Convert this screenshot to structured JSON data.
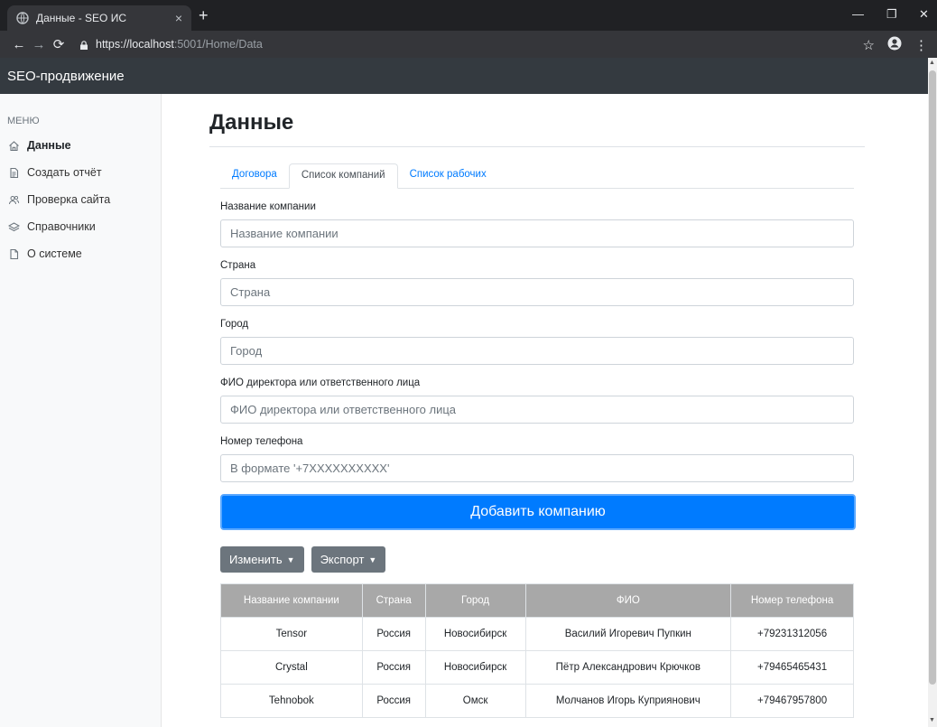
{
  "browser": {
    "tab_title": "Данные - SEO ИС",
    "tab_close": "×",
    "new_tab": "+",
    "url_host": "https://localhost",
    "url_path": ":5001/Home/Data"
  },
  "app": {
    "brand": "SEO-продвижение"
  },
  "sidebar": {
    "heading": "МЕНЮ",
    "items": [
      {
        "label": "Данные",
        "icon": "home-icon",
        "active": true
      },
      {
        "label": "Создать отчёт",
        "icon": "file-icon"
      },
      {
        "label": "Проверка сайта",
        "icon": "users-icon"
      },
      {
        "label": "Справочники",
        "icon": "layers-icon"
      },
      {
        "label": "О системе",
        "icon": "file-icon"
      }
    ]
  },
  "main": {
    "title": "Данные",
    "tabs": [
      "Договора",
      "Список компаний",
      "Список рабочих"
    ],
    "active_tab": 1
  },
  "form": {
    "company_label": "Название компании",
    "company_placeholder": "Название компании",
    "country_label": "Страна",
    "country_placeholder": "Страна",
    "city_label": "Город",
    "city_placeholder": "Город",
    "director_label": "ФИО директора или ответственного лица",
    "director_placeholder": "ФИО директора или ответственного лица",
    "phone_label": "Номер телефона",
    "phone_placeholder": "В формате '+7XXXXXXXXXX'",
    "submit_label": "Добавить компанию"
  },
  "actions": {
    "edit_label": "Изменить",
    "export_label": "Экспорт"
  },
  "table": {
    "headers": [
      "Название компании",
      "Страна",
      "Город",
      "ФИО",
      "Номер телефона"
    ],
    "rows": [
      [
        "Tensor",
        "Россия",
        "Новосибирск",
        "Василий Игоревич Пупкин",
        "+79231312056"
      ],
      [
        "Crystal",
        "Россия",
        "Новосибирск",
        "Пётр Александрович Крючков",
        "+79465465431"
      ],
      [
        "Tehnobok",
        "Россия",
        "Омск",
        "Молчанов Игорь Куприянович",
        "+79467957800"
      ]
    ]
  },
  "colors": {
    "primary": "#007bff",
    "secondary": "#6c757d",
    "navbar": "#343a40",
    "table_header": "#a8a8a8"
  }
}
